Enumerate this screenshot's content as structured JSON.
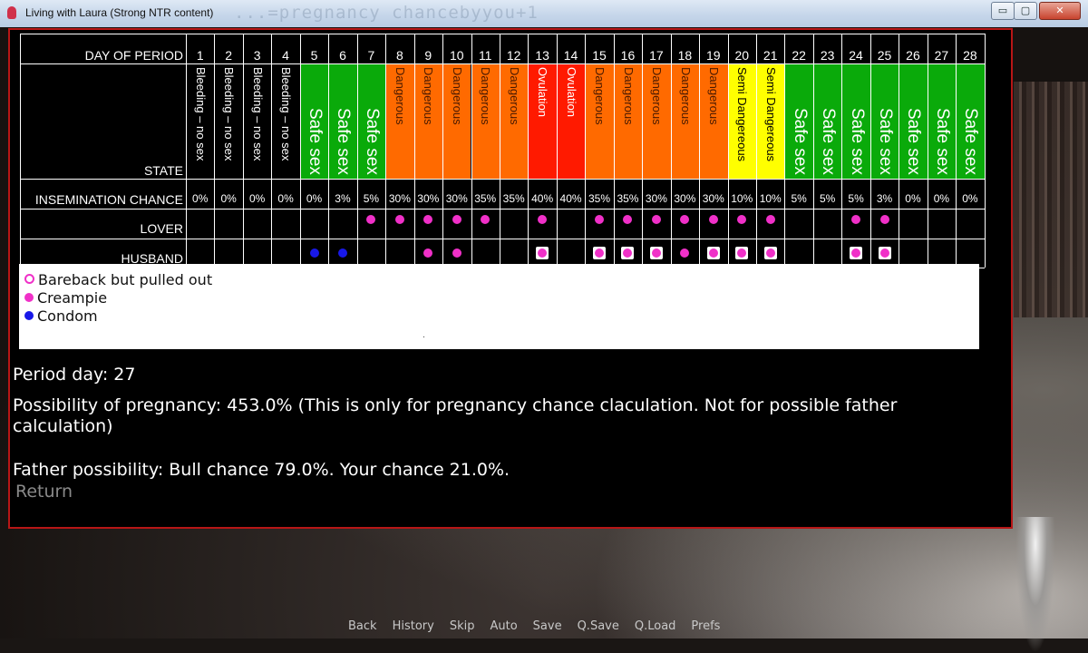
{
  "window": {
    "title": "Living with Laura (Strong NTR content)",
    "watermark_title": "...=pregnancy chancebyyou+1",
    "controls": {
      "minimize": "▭",
      "maximize": "▢",
      "close": "✕"
    }
  },
  "calendar": {
    "row_labels": {
      "day": "DAY OF PERIOD",
      "state": "STATE",
      "chance": "INSEMINATION CHANCE",
      "lover": "LOVER",
      "husband": "HUSBAND"
    },
    "colors": {
      "bleeding": "#000000",
      "safe": "#0aaa0a",
      "dangerous": "#ff6a00",
      "ovulation": "#ff1a00",
      "semi": "#ffff00"
    },
    "days": [
      {
        "day": "1",
        "state": "Bleeding – no sex",
        "kind": "bleeding",
        "chance": "0%",
        "lover": "",
        "husband": ""
      },
      {
        "day": "2",
        "state": "Bleeding – no sex",
        "kind": "bleeding",
        "chance": "0%",
        "lover": "",
        "husband": ""
      },
      {
        "day": "3",
        "state": "Bleeding – no sex",
        "kind": "bleeding",
        "chance": "0%",
        "lover": "",
        "husband": ""
      },
      {
        "day": "4",
        "state": "Bleeding – no sex",
        "kind": "bleeding",
        "chance": "0%",
        "lover": "",
        "husband": ""
      },
      {
        "day": "5",
        "state": "Safe sex",
        "kind": "safe",
        "chance": "0%",
        "lover": "",
        "husband": "condom"
      },
      {
        "day": "6",
        "state": "Safe sex",
        "kind": "safe",
        "chance": "3%",
        "lover": "",
        "husband": "condom"
      },
      {
        "day": "7",
        "state": "Safe sex",
        "kind": "safe",
        "chance": "5%",
        "lover": "creampie",
        "husband": ""
      },
      {
        "day": "8",
        "state": "Dangerous",
        "kind": "dangerous",
        "chance": "30%",
        "lover": "creampie",
        "husband": ""
      },
      {
        "day": "9",
        "state": "Dangerous",
        "kind": "dangerous",
        "chance": "30%",
        "lover": "creampie",
        "husband": "creampie"
      },
      {
        "day": "10",
        "state": "Dangerous",
        "kind": "dangerous",
        "chance": "30%",
        "lover": "creampie",
        "husband": "creampie"
      },
      {
        "day": "11",
        "state": "Dangerous",
        "kind": "dangerous",
        "chance": "35%",
        "lover": "creampie",
        "husband": ""
      },
      {
        "day": "12",
        "state": "Dangerous",
        "kind": "dangerous",
        "chance": "35%",
        "lover": "",
        "husband": ""
      },
      {
        "day": "13",
        "state": "Ovulation",
        "kind": "ovulation",
        "chance": "40%",
        "lover": "creampie",
        "husband": "pulled"
      },
      {
        "day": "14",
        "state": "Ovulation",
        "kind": "ovulation",
        "chance": "40%",
        "lover": "",
        "husband": ""
      },
      {
        "day": "15",
        "state": "Dangerous",
        "kind": "dangerous",
        "chance": "35%",
        "lover": "creampie",
        "husband": "pulled"
      },
      {
        "day": "16",
        "state": "Dangerous",
        "kind": "dangerous",
        "chance": "35%",
        "lover": "creampie",
        "husband": "pulled"
      },
      {
        "day": "17",
        "state": "Dangerous",
        "kind": "dangerous",
        "chance": "30%",
        "lover": "creampie",
        "husband": "pulled"
      },
      {
        "day": "18",
        "state": "Dangerous",
        "kind": "dangerous",
        "chance": "30%",
        "lover": "creampie",
        "husband": "creampie"
      },
      {
        "day": "19",
        "state": "Dangerous",
        "kind": "dangerous",
        "chance": "30%",
        "lover": "creampie",
        "husband": "pulled"
      },
      {
        "day": "20",
        "state": "Semi Dangereous",
        "kind": "semi",
        "chance": "10%",
        "lover": "creampie",
        "husband": "pulled"
      },
      {
        "day": "21",
        "state": "Semi Dangereous",
        "kind": "semi",
        "chance": "10%",
        "lover": "creampie",
        "husband": "pulled"
      },
      {
        "day": "22",
        "state": "Safe sex",
        "kind": "safe",
        "chance": "5%",
        "lover": "",
        "husband": ""
      },
      {
        "day": "23",
        "state": "Safe sex",
        "kind": "safe",
        "chance": "5%",
        "lover": "",
        "husband": ""
      },
      {
        "day": "24",
        "state": "Safe sex",
        "kind": "safe",
        "chance": "5%",
        "lover": "creampie",
        "husband": "pulled"
      },
      {
        "day": "25",
        "state": "Safe sex",
        "kind": "safe",
        "chance": "3%",
        "lover": "creampie",
        "husband": "pulled"
      },
      {
        "day": "26",
        "state": "Safe sex",
        "kind": "safe",
        "chance": "0%",
        "lover": "",
        "husband": ""
      },
      {
        "day": "27",
        "state": "Safe sex",
        "kind": "safe",
        "chance": "0%",
        "lover": "",
        "husband": ""
      },
      {
        "day": "28",
        "state": "Safe sex",
        "kind": "safe",
        "chance": "0%",
        "lover": "",
        "husband": ""
      }
    ]
  },
  "legend": {
    "pulled": "Bareback but pulled out",
    "creampie": "Creampie",
    "condom": "Condom"
  },
  "info": {
    "period_day": "Period day: 27",
    "pregnancy": "Possibility of pregnancy: 453.0% (This is only for pregnancy chance claculation. Not for possible father",
    "pregnancy_cont": "calculation)",
    "father": "Father possibility: Bull chance 79.0%. Your chance 21.0%.",
    "return": "Return"
  },
  "quick_menu": [
    "Back",
    "History",
    "Skip",
    "Auto",
    "Save",
    "Q.Save",
    "Q.Load",
    "Prefs"
  ]
}
